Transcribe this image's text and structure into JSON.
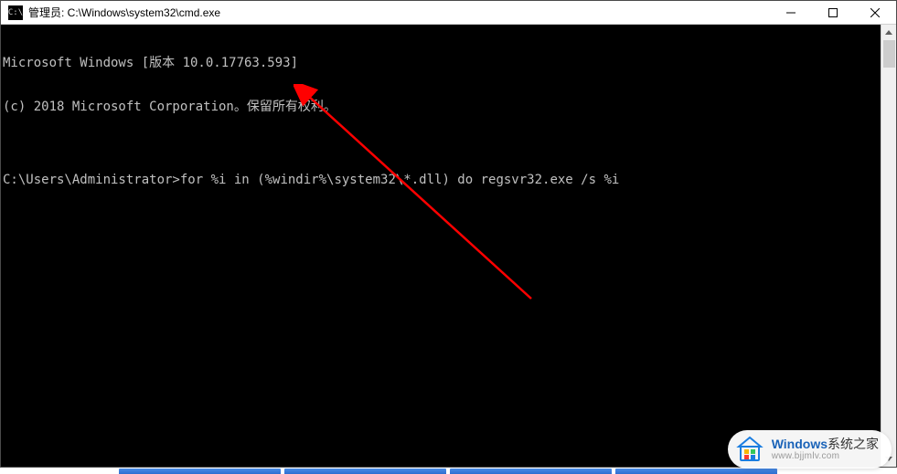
{
  "titlebar": {
    "icon_label": "C:\\",
    "title": "管理员: C:\\Windows\\system32\\cmd.exe",
    "minimize": "—",
    "maximize": "□",
    "close": "✕"
  },
  "console": {
    "line1": "Microsoft Windows [版本 10.0.17763.593]",
    "line2": "(c) 2018 Microsoft Corporation。保留所有权利。",
    "blank": "",
    "prompt": "C:\\Users\\Administrator>",
    "command": "for %i in (%windir%\\system32\\*.dll) do regsvr32.exe /s %i"
  },
  "annotation": {
    "arrow_color": "#ff0000"
  },
  "watermark": {
    "brand_en": "Windows",
    "brand_cn": "系统之家",
    "url": "www.bjjmlv.com"
  }
}
